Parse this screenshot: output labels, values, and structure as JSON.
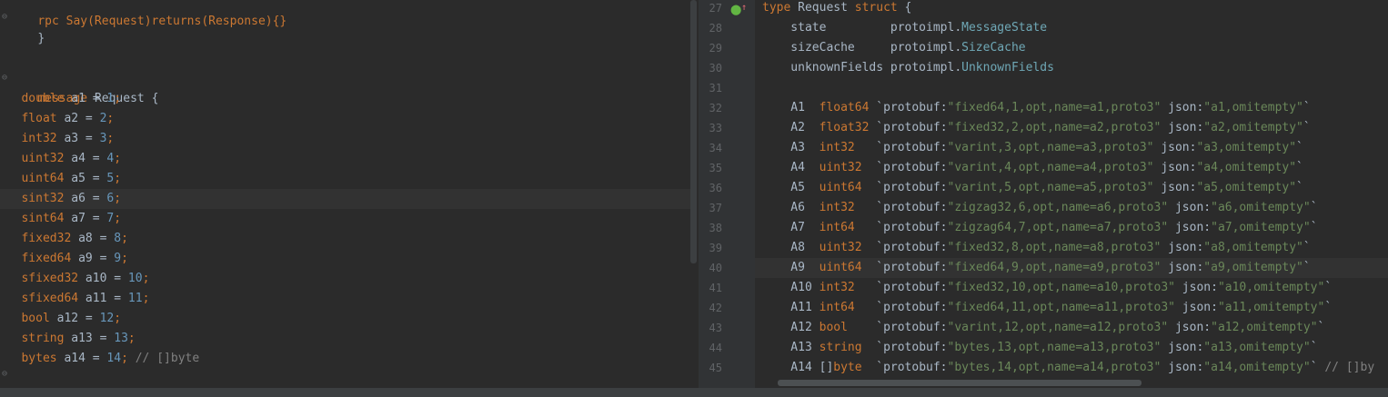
{
  "left_editor": {
    "top_partial": "rpc Say(Request)returns(Response){}",
    "brace_close_1": "}",
    "message_keyword": "message",
    "message_name": "Request",
    "message_open": "{",
    "fields": [
      {
        "type": "double",
        "name": "a1",
        "num": "1"
      },
      {
        "type": "float",
        "name": "a2",
        "num": "2"
      },
      {
        "type": "int32",
        "name": "a3",
        "num": "3"
      },
      {
        "type": "uint32",
        "name": "a4",
        "num": "4"
      },
      {
        "type": "uint64",
        "name": "a5",
        "num": "5"
      },
      {
        "type": "sint32",
        "name": "a6",
        "num": "6"
      },
      {
        "type": "sint64",
        "name": "a7",
        "num": "7"
      },
      {
        "type": "fixed32",
        "name": "a8",
        "num": "8"
      },
      {
        "type": "fixed64",
        "name": "a9",
        "num": "9"
      },
      {
        "type": "sfixed32",
        "name": "a10",
        "num": "10"
      },
      {
        "type": "sfixed64",
        "name": "a11",
        "num": "11"
      },
      {
        "type": "bool",
        "name": "a12",
        "num": "12"
      },
      {
        "type": "string",
        "name": "a13",
        "num": "13"
      },
      {
        "type": "bytes",
        "name": "a14",
        "num": "14",
        "comment": "// []byte"
      }
    ],
    "brace_close_2": "}"
  },
  "right_editor": {
    "lines": [
      {
        "n": "27",
        "text_parts": [
          [
            "kw",
            "type"
          ],
          [
            "plain",
            " Request "
          ],
          [
            "kw",
            "struct"
          ],
          [
            "plain",
            " {"
          ]
        ]
      },
      {
        "n": "28",
        "text_parts": [
          [
            "plain",
            "    state         protoimpl."
          ],
          [
            "ty",
            "MessageState"
          ]
        ]
      },
      {
        "n": "29",
        "text_parts": [
          [
            "plain",
            "    sizeCache     protoimpl."
          ],
          [
            "ty",
            "SizeCache"
          ]
        ]
      },
      {
        "n": "30",
        "text_parts": [
          [
            "plain",
            "    unknownFields protoimpl."
          ],
          [
            "ty",
            "UnknownFields"
          ]
        ]
      },
      {
        "n": "31",
        "text_parts": []
      },
      {
        "n": "32",
        "text_parts": [
          [
            "plain",
            "    A1  "
          ],
          [
            "kw",
            "float64"
          ],
          [
            "plain",
            " `protobuf:"
          ],
          [
            "str",
            "\"fixed64,1,opt,name=a1,proto3\""
          ],
          [
            "plain",
            " json:"
          ],
          [
            "str",
            "\"a1,omitempty\""
          ],
          [
            "plain",
            "`"
          ]
        ]
      },
      {
        "n": "33",
        "text_parts": [
          [
            "plain",
            "    A2  "
          ],
          [
            "kw",
            "float32"
          ],
          [
            "plain",
            " `protobuf:"
          ],
          [
            "str",
            "\"fixed32,2,opt,name=a2,proto3\""
          ],
          [
            "plain",
            " json:"
          ],
          [
            "str",
            "\"a2,omitempty\""
          ],
          [
            "plain",
            "`"
          ]
        ]
      },
      {
        "n": "34",
        "text_parts": [
          [
            "plain",
            "    A3  "
          ],
          [
            "kw",
            "int32"
          ],
          [
            "plain",
            "   `protobuf:"
          ],
          [
            "str",
            "\"varint,3,opt,name=a3,proto3\""
          ],
          [
            "plain",
            " json:"
          ],
          [
            "str",
            "\"a3,omitempty\""
          ],
          [
            "plain",
            "`"
          ]
        ]
      },
      {
        "n": "35",
        "text_parts": [
          [
            "plain",
            "    A4  "
          ],
          [
            "kw",
            "uint32"
          ],
          [
            "plain",
            "  `protobuf:"
          ],
          [
            "str",
            "\"varint,4,opt,name=a4,proto3\""
          ],
          [
            "plain",
            " json:"
          ],
          [
            "str",
            "\"a4,omitempty\""
          ],
          [
            "plain",
            "`"
          ]
        ]
      },
      {
        "n": "36",
        "text_parts": [
          [
            "plain",
            "    A5  "
          ],
          [
            "kw",
            "uint64"
          ],
          [
            "plain",
            "  `protobuf:"
          ],
          [
            "str",
            "\"varint,5,opt,name=a5,proto3\""
          ],
          [
            "plain",
            " json:"
          ],
          [
            "str",
            "\"a5,omitempty\""
          ],
          [
            "plain",
            "`"
          ]
        ]
      },
      {
        "n": "37",
        "text_parts": [
          [
            "plain",
            "    A6  "
          ],
          [
            "kw",
            "int32"
          ],
          [
            "plain",
            "   `protobuf:"
          ],
          [
            "str",
            "\"zigzag32,6,opt,name=a6,proto3\""
          ],
          [
            "plain",
            " json:"
          ],
          [
            "str",
            "\"a6,omitempty\""
          ],
          [
            "plain",
            "`"
          ]
        ]
      },
      {
        "n": "38",
        "text_parts": [
          [
            "plain",
            "    A7  "
          ],
          [
            "kw",
            "int64"
          ],
          [
            "plain",
            "   `protobuf:"
          ],
          [
            "str",
            "\"zigzag64,7,opt,name=a7,proto3\""
          ],
          [
            "plain",
            " json:"
          ],
          [
            "str",
            "\"a7,omitempty\""
          ],
          [
            "plain",
            "`"
          ]
        ]
      },
      {
        "n": "39",
        "text_parts": [
          [
            "plain",
            "    A8  "
          ],
          [
            "kw",
            "uint32"
          ],
          [
            "plain",
            "  `protobuf:"
          ],
          [
            "str",
            "\"fixed32,8,opt,name=a8,proto3\""
          ],
          [
            "plain",
            " json:"
          ],
          [
            "str",
            "\"a8,omitempty\""
          ],
          [
            "plain",
            "`"
          ]
        ]
      },
      {
        "n": "40",
        "text_parts": [
          [
            "plain",
            "    A9  "
          ],
          [
            "kw",
            "uint64"
          ],
          [
            "plain",
            "  `protobuf:"
          ],
          [
            "str",
            "\"fixed64,9,opt,name=a9,proto3\""
          ],
          [
            "plain",
            " json:"
          ],
          [
            "str",
            "\"a9,omitempty\""
          ],
          [
            "plain",
            "`"
          ]
        ]
      },
      {
        "n": "41",
        "text_parts": [
          [
            "plain",
            "    A10 "
          ],
          [
            "kw",
            "int32"
          ],
          [
            "plain",
            "   `protobuf:"
          ],
          [
            "str",
            "\"fixed32,10,opt,name=a10,proto3\""
          ],
          [
            "plain",
            " json:"
          ],
          [
            "str",
            "\"a10,omitempty\""
          ],
          [
            "plain",
            "`"
          ]
        ]
      },
      {
        "n": "42",
        "text_parts": [
          [
            "plain",
            "    A11 "
          ],
          [
            "kw",
            "int64"
          ],
          [
            "plain",
            "   `protobuf:"
          ],
          [
            "str",
            "\"fixed64,11,opt,name=a11,proto3\""
          ],
          [
            "plain",
            " json:"
          ],
          [
            "str",
            "\"a11,omitempty\""
          ],
          [
            "plain",
            "`"
          ]
        ]
      },
      {
        "n": "43",
        "text_parts": [
          [
            "plain",
            "    A12 "
          ],
          [
            "kw",
            "bool"
          ],
          [
            "plain",
            "    `protobuf:"
          ],
          [
            "str",
            "\"varint,12,opt,name=a12,proto3\""
          ],
          [
            "plain",
            " json:"
          ],
          [
            "str",
            "\"a12,omitempty\""
          ],
          [
            "plain",
            "`"
          ]
        ]
      },
      {
        "n": "44",
        "text_parts": [
          [
            "plain",
            "    A13 "
          ],
          [
            "kw",
            "string"
          ],
          [
            "plain",
            "  `protobuf:"
          ],
          [
            "str",
            "\"bytes,13,opt,name=a13,proto3\""
          ],
          [
            "plain",
            " json:"
          ],
          [
            "str",
            "\"a13,omitempty\""
          ],
          [
            "plain",
            "`"
          ]
        ]
      },
      {
        "n": "45",
        "text_parts": [
          [
            "plain",
            "    A14 []"
          ],
          [
            "kw",
            "byte"
          ],
          [
            "plain",
            "  `protobuf:"
          ],
          [
            "str",
            "\"bytes,14,opt,name=a14,proto3\""
          ],
          [
            "plain",
            " json:"
          ],
          [
            "str",
            "\"a14,omitempty\""
          ],
          [
            "plain",
            "` "
          ],
          [
            "cm",
            "// []by"
          ]
        ]
      }
    ]
  },
  "colors": {
    "background": "#2b2b2b",
    "keyword": "#cc7832",
    "number": "#6897bb",
    "string": "#6a8759",
    "comment": "#808080",
    "type_ref": "#6fa8b6"
  }
}
